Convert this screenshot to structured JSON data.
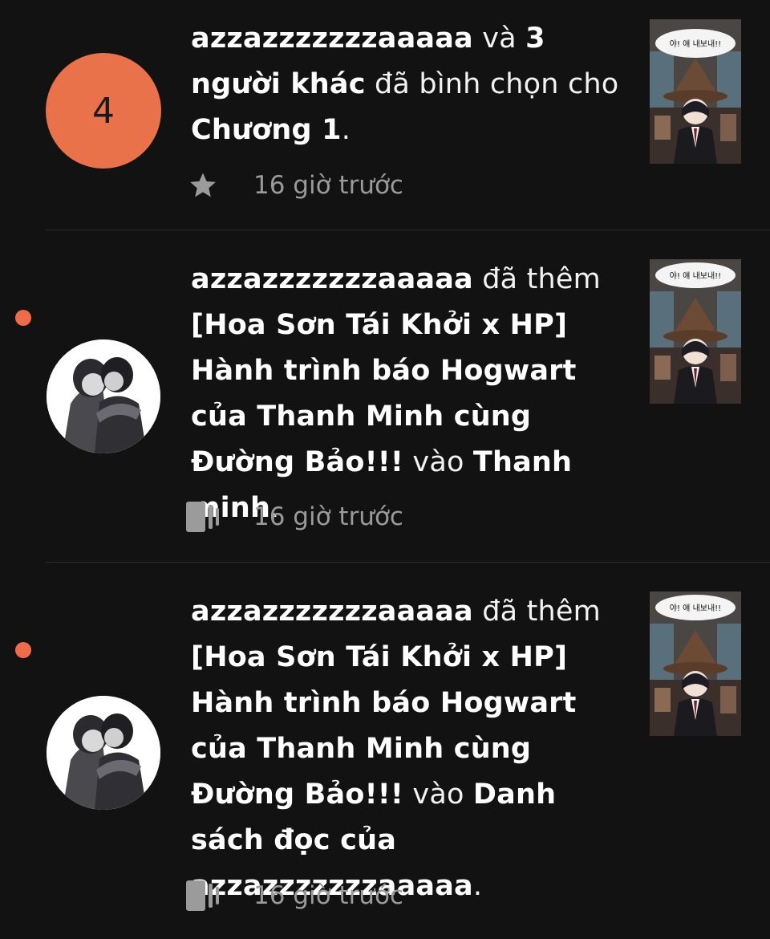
{
  "notifications": [
    {
      "type": "vote",
      "avatar_count": "4",
      "actor": "azzazzzzzzzaaaaa",
      "connector": " và ",
      "others": "3 người khác",
      "verb": " đã bình chọn cho ",
      "target": "Chương 1",
      "end": ".",
      "icon": "star-icon",
      "time": "16 giờ trước",
      "unread": false,
      "cover_caption": "야! 얘 내보내!!"
    },
    {
      "type": "add-to-list",
      "actor": "azzazzzzzzzaaaaa",
      "verb": " đã thêm ",
      "story": "[Hoa Sơn Tái Khởi x HP] Hành trình báo Hogwart của Thanh Minh cùng Đường Bảo!!!",
      "connector": " vào ",
      "list": "Thanh minh",
      "end": ".",
      "icon": "reading-list-icon",
      "time": "16 giờ trước",
      "unread": true,
      "cover_caption": "야! 얘 내보내!!"
    },
    {
      "type": "add-to-list",
      "actor": "azzazzzzzzzaaaaa",
      "verb": " đã thêm ",
      "story": "[Hoa Sơn Tái Khởi x HP] Hành trình báo Hogwart của Thanh Minh cùng Đường Bảo!!!",
      "connector": " vào ",
      "list": "Danh sách đọc của azzazzzzzzzaaaaa",
      "end": ".",
      "icon": "reading-list-icon",
      "time": "16 giờ trước",
      "unread": true,
      "cover_caption": "야! 얘 내보내!!"
    }
  ],
  "colors": {
    "background": "#121212",
    "accent": "#f06b49",
    "count_badge": "#e9724b",
    "muted_text": "#9a9a9a"
  }
}
